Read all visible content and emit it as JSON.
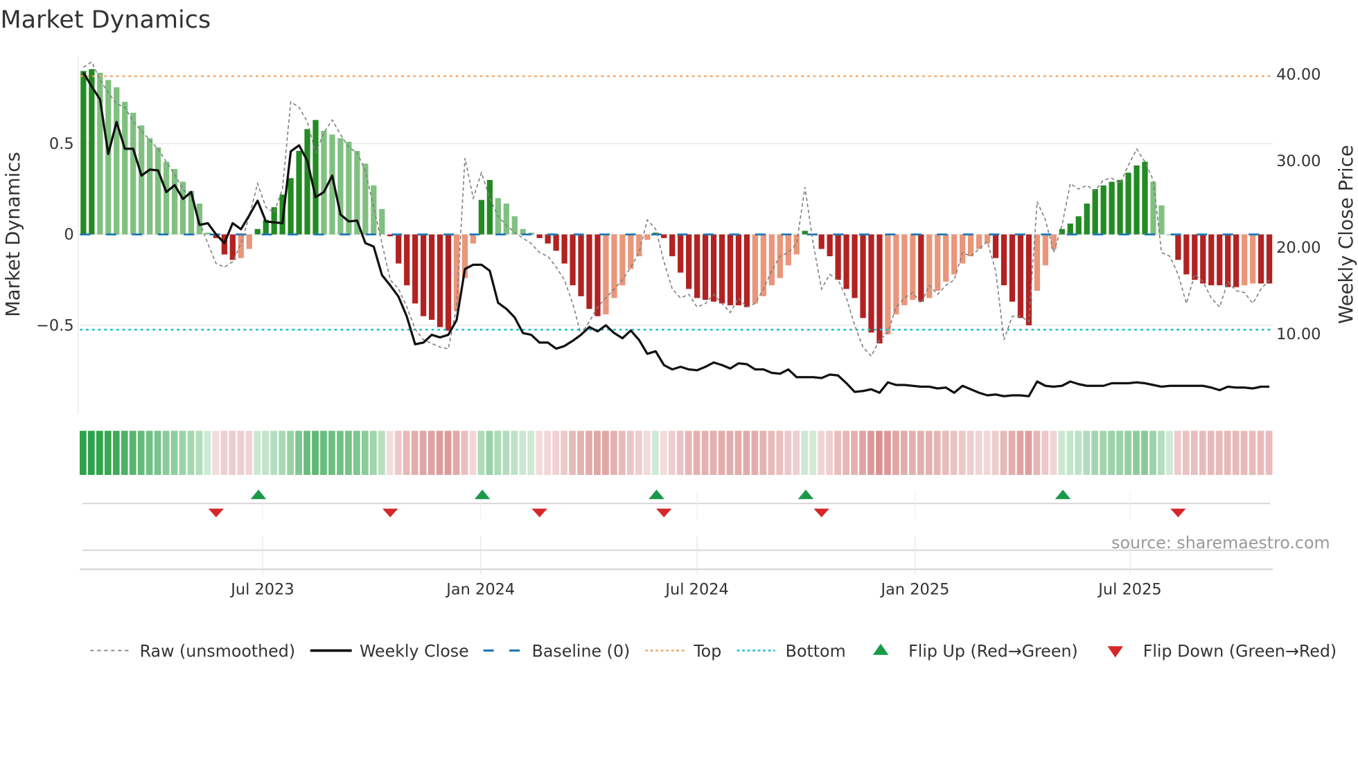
{
  "chart_data": {
    "type": "bar",
    "title": "Market Dynamics",
    "ylabel": "Market Dynamics",
    "y2label": "Weekly Close Price",
    "ylim": [
      -0.98,
      1.0
    ],
    "y2lim": [
      -0.6,
      41.0
    ],
    "yticks": [
      {
        "value": 0.5,
        "label": "0.5"
      },
      {
        "value": 0,
        "label": "0"
      },
      {
        "value": -0.5,
        "label": "−0.5"
      }
    ],
    "y2ticks": [
      {
        "value": 40,
        "label": "40.00"
      },
      {
        "value": 30,
        "label": "30.00"
      },
      {
        "value": 20,
        "label": "20.00"
      },
      {
        "value": 10,
        "label": "10.00"
      }
    ],
    "xticks": [
      {
        "week": 21.6,
        "label": "Jul 2023"
      },
      {
        "week": 47.9,
        "label": "Jan 2024"
      },
      {
        "week": 74.0,
        "label": "Jul 2024"
      },
      {
        "week": 100.3,
        "label": "Jan 2025"
      },
      {
        "week": 126.2,
        "label": "Jul 2025"
      }
    ],
    "top_level": 0.871,
    "bottom_level": -0.524,
    "baseline": 0,
    "momentum": [
      0.9,
      0.91,
      0.89,
      0.85,
      0.81,
      0.73,
      0.67,
      0.6,
      0.53,
      0.48,
      0.4,
      0.36,
      0.29,
      0.24,
      0.17,
      0.01,
      -0.02,
      -0.11,
      -0.14,
      -0.13,
      -0.08,
      0.03,
      0.08,
      0.15,
      0.22,
      0.31,
      0.46,
      0.58,
      0.63,
      0.57,
      0.55,
      0.53,
      0.51,
      0.46,
      0.39,
      0.27,
      0.14,
      -0.01,
      -0.16,
      -0.28,
      -0.38,
      -0.45,
      -0.47,
      -0.51,
      -0.53,
      -0.42,
      -0.24,
      -0.05,
      0.19,
      0.3,
      0.2,
      0.17,
      0.1,
      0.03,
      0.01,
      -0.02,
      -0.05,
      -0.09,
      -0.16,
      -0.28,
      -0.34,
      -0.41,
      -0.45,
      -0.44,
      -0.35,
      -0.28,
      -0.19,
      -0.12,
      -0.03,
      0.01,
      -0.02,
      -0.12,
      -0.21,
      -0.3,
      -0.35,
      -0.36,
      -0.37,
      -0.38,
      -0.39,
      -0.39,
      -0.4,
      -0.38,
      -0.34,
      -0.28,
      -0.24,
      -0.17,
      -0.11,
      0.02,
      0.0,
      -0.08,
      -0.12,
      -0.25,
      -0.3,
      -0.35,
      -0.46,
      -0.54,
      -0.6,
      -0.55,
      -0.44,
      -0.39,
      -0.36,
      -0.37,
      -0.35,
      -0.31,
      -0.26,
      -0.22,
      -0.16,
      -0.12,
      -0.08,
      -0.05,
      -0.13,
      -0.28,
      -0.37,
      -0.46,
      -0.5,
      -0.31,
      -0.17,
      -0.08,
      0.03,
      0.06,
      0.1,
      0.17,
      0.25,
      0.27,
      0.29,
      0.3,
      0.34,
      0.38,
      0.4,
      0.29,
      0.16,
      0.0,
      -0.14,
      -0.22,
      -0.25,
      -0.27,
      -0.28,
      -0.28,
      -0.29,
      -0.29,
      -0.28,
      -0.27,
      -0.27,
      -0.27
    ],
    "raw": [
      0.92,
      0.95,
      0.85,
      0.78,
      0.72,
      0.7,
      0.62,
      0.57,
      0.52,
      0.47,
      0.4,
      0.33,
      0.25,
      0.2,
      0.07,
      -0.05,
      -0.16,
      -0.18,
      -0.15,
      -0.05,
      0.1,
      0.28,
      0.15,
      0.12,
      0.25,
      0.73,
      0.7,
      0.62,
      0.45,
      0.56,
      0.63,
      0.55,
      0.48,
      0.45,
      0.35,
      0.15,
      -0.05,
      -0.25,
      -0.3,
      -0.4,
      -0.52,
      -0.58,
      -0.6,
      -0.62,
      -0.63,
      -0.4,
      0.42,
      0.2,
      0.34,
      0.2,
      0.1,
      0.05,
      0.01,
      -0.02,
      -0.05,
      -0.1,
      -0.12,
      -0.18,
      -0.25,
      -0.38,
      -0.55,
      -0.48,
      -0.4,
      -0.35,
      -0.3,
      -0.25,
      -0.18,
      -0.1,
      0.08,
      0.03,
      -0.15,
      -0.3,
      -0.35,
      -0.33,
      -0.4,
      -0.38,
      -0.33,
      -0.38,
      -0.43,
      -0.35,
      -0.4,
      -0.38,
      -0.3,
      -0.2,
      -0.12,
      -0.1,
      -0.05,
      0.26,
      -0.05,
      -0.3,
      -0.22,
      -0.25,
      -0.35,
      -0.5,
      -0.62,
      -0.67,
      -0.58,
      -0.54,
      -0.4,
      -0.35,
      -0.32,
      -0.38,
      -0.28,
      -0.33,
      -0.28,
      -0.25,
      -0.1,
      -0.12,
      -0.08,
      -0.04,
      -0.2,
      -0.58,
      -0.45,
      -0.45,
      -0.48,
      0.18,
      0.08,
      -0.1,
      0.05,
      0.28,
      0.25,
      0.27,
      0.24,
      0.3,
      0.31,
      0.28,
      0.38,
      0.47,
      0.4,
      0.3,
      -0.1,
      -0.12,
      -0.22,
      -0.38,
      -0.22,
      -0.26,
      -0.35,
      -0.4,
      -0.26,
      -0.31,
      -0.32,
      -0.38,
      -0.3,
      -0.25
    ],
    "weekly_close": [
      40.2,
      38.6,
      37.1,
      30.8,
      34.5,
      31.4,
      31.4,
      28.3,
      29,
      28.9,
      26.4,
      27.2,
      25.6,
      26.4,
      22.6,
      22.8,
      21.5,
      20.5,
      22.8,
      22.1,
      23.7,
      25.4,
      23,
      22.9,
      22.8,
      31.1,
      31.8,
      30,
      25.8,
      26.4,
      28.3,
      23.8,
      23,
      23.1,
      20.5,
      20.1,
      16.8,
      15.6,
      14.3,
      12,
      8.8,
      9,
      9.9,
      9.6,
      9.9,
      11.6,
      17.5,
      18,
      18,
      17.3,
      13.6,
      12.9,
      11.9,
      10.1,
      9.9,
      9,
      9,
      8.3,
      8.6,
      9.2,
      9.9,
      10.8,
      10.3,
      11,
      10.1,
      9.5,
      10.4,
      9.3,
      7.7,
      8,
      6.4,
      5.9,
      6.2,
      5.9,
      5.8,
      6.2,
      6.7,
      6.4,
      6,
      6.6,
      6.5,
      5.9,
      5.9,
      5.5,
      5.4,
      5.9,
      5,
      5,
      5,
      4.9,
      5.3,
      5.2,
      4.3,
      3.3,
      3.4,
      3.6,
      3.2,
      4.4,
      4.1,
      4.1,
      4,
      3.9,
      3.9,
      3.7,
      3.8,
      3.2,
      4,
      3.6,
      3.2,
      2.9,
      3,
      2.8,
      2.9,
      2.9,
      2.8,
      4.5,
      4,
      3.9,
      4,
      4.5,
      4.2,
      4,
      4,
      4,
      4.3,
      4.3,
      4.3,
      4.4,
      4.3,
      4.1,
      3.9,
      4,
      4,
      4,
      4,
      4,
      3.8,
      3.5,
      3.9,
      3.8,
      3.8,
      3.7,
      3.9,
      3.9
    ],
    "flip_up_weeks": [
      21,
      48,
      69,
      87,
      118
    ],
    "flip_down_weeks": [
      16,
      37,
      55,
      70,
      89,
      132
    ],
    "colors": {
      "rising_positive": "#228b22",
      "falling_positive": "#80c080",
      "falling_negative": "#b22222",
      "rising_negative": "#e9967a",
      "raw": "#808080",
      "close": "#111111",
      "baseline": "#1f77b4",
      "top": "#f4a460",
      "bottom": "#17becf",
      "flip_up": "#1a9a48",
      "flip_down": "#d62728"
    },
    "legend": {
      "placement": "bottom",
      "items": [
        "Raw (unsmoothed)",
        "Weekly Close",
        "Baseline (0)",
        "Top",
        "Bottom",
        "Flip Up (Red→Green)",
        "Flip Down (Green→Red)"
      ]
    },
    "source": "source: sharemaestro.com"
  }
}
